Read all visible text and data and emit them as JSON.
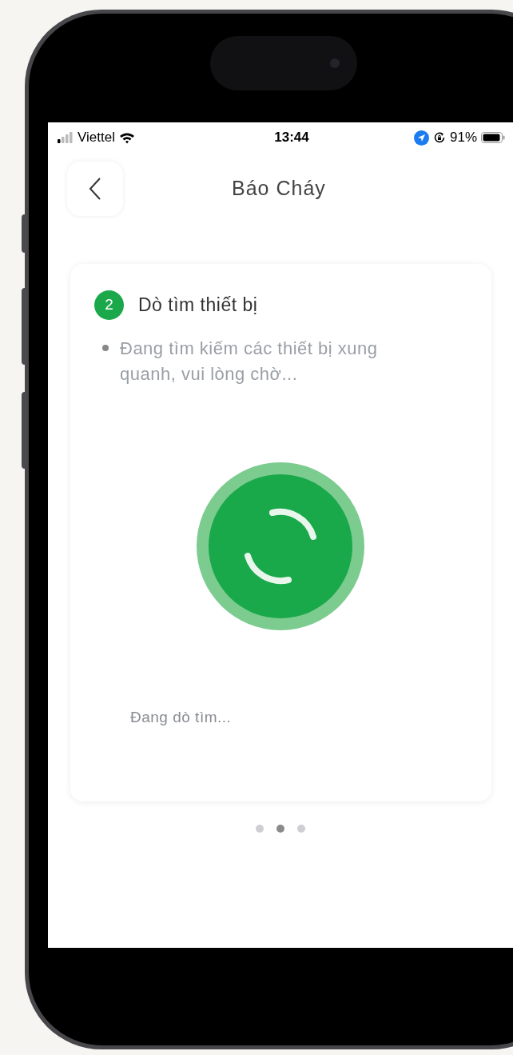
{
  "status_bar": {
    "carrier": "Viettel",
    "time": "13:44",
    "battery": "91%"
  },
  "header": {
    "title": "Báo Cháy"
  },
  "step": {
    "number": "2",
    "title": "Dò tìm thiết bị",
    "bullets": [
      "Đang tìm kiếm các thiết bị xung quanh, vui lòng chờ..."
    ],
    "status": "Đang dò tìm..."
  },
  "pager": [
    {
      "selected": false
    },
    {
      "selected": true
    },
    {
      "selected": false
    }
  ]
}
